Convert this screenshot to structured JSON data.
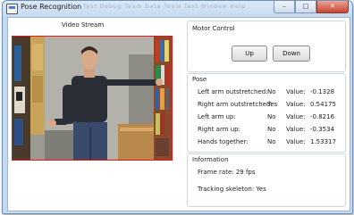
{
  "window": {
    "title": "Pose Recognition",
    "background_menu": "Test   Debug   Team   Data   Tools   Test   Window   Help",
    "caption": {
      "minimize": "–",
      "maximize": "□",
      "close": "✕"
    }
  },
  "video": {
    "label": "Video Stream"
  },
  "motor": {
    "title": "Motor Control",
    "up_label": "Up",
    "down_label": "Down"
  },
  "pose": {
    "title": "Pose",
    "value_label": "Value:",
    "rows": [
      {
        "label": "Left arm outstretched:",
        "state": "No",
        "value": "-0.1328"
      },
      {
        "label": "Right arm outstretched:",
        "state": "Yes",
        "value": "0.54175"
      },
      {
        "label": "Left arm up:",
        "state": "No",
        "value": "-0.8216"
      },
      {
        "label": "Right arm up:",
        "state": "No",
        "value": "-0.3534"
      },
      {
        "label": "Hands together:",
        "state": "No",
        "value": "1.53317"
      }
    ]
  },
  "information": {
    "title": "Information",
    "frame_rate": "Frame rate: 29 fps",
    "tracking": "Tracking skeleton: Yes"
  },
  "colors": {
    "tracking_border": "#e01818",
    "window_frame": "#c6d9f0"
  }
}
